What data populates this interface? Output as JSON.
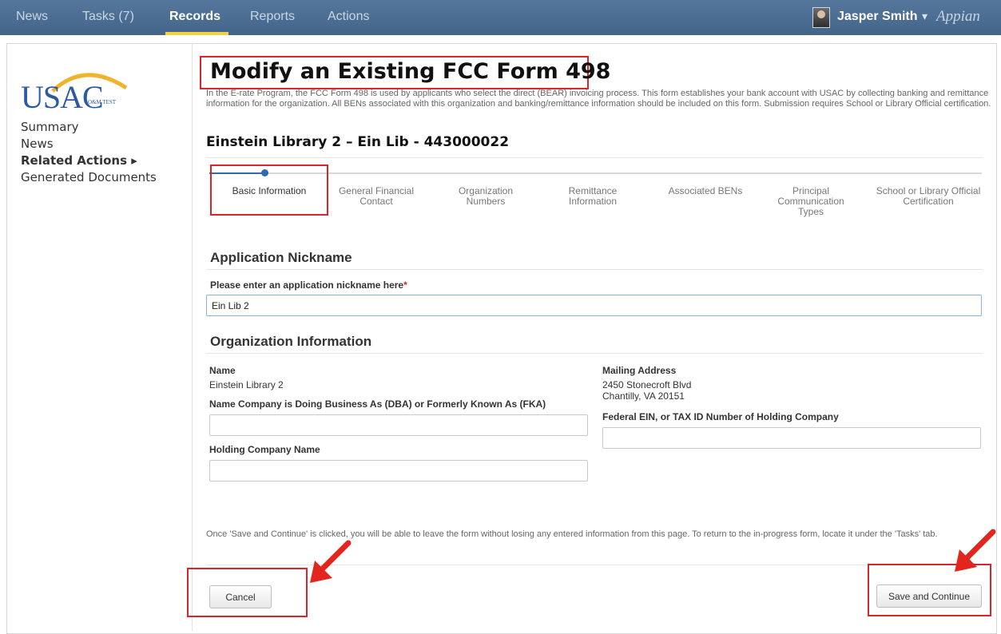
{
  "nav": {
    "items": [
      "News",
      "Tasks (7)",
      "Records",
      "Reports",
      "Actions"
    ],
    "active": "Records",
    "user_name": "Jasper Smith",
    "user_caret": "▾",
    "brand": "Appian"
  },
  "sidebar": {
    "logo_text": "USAC",
    "logo_subtext": "O&M TEST",
    "links": [
      "Summary",
      "News",
      "Related Actions ▸",
      "Generated Documents"
    ]
  },
  "page": {
    "title": "Modify an Existing FCC Form 498",
    "intro": "In the E-rate Program, the FCC Form 498 is used by applicants who select the direct (BEAR) invoicing process. This form establishes your bank account with USAC by collecting banking and remittance information for the organization. All BENs associated with this organization and banking/remittance information should be included on this form. Submission requires School or Library Official certification.",
    "record_title": "Einstein Library 2 – Ein Lib - 443000022"
  },
  "steps": [
    "Basic Information",
    "General Financial Contact",
    "Organization Numbers",
    "Remittance Information",
    "Associated BENs",
    "Principal Communication Types",
    "School or Library Official Certification"
  ],
  "application": {
    "heading": "Application Nickname",
    "nickname_label": "Please enter an application nickname here",
    "required_mark": "*",
    "nickname_value": "Ein Lib 2"
  },
  "organization": {
    "heading": "Organization Information",
    "name_label": "Name",
    "name_value": "Einstein Library 2",
    "dba_label": "Name Company is Doing Business As (DBA) or Formerly Known As (FKA)",
    "dba_value": "",
    "holding_label": "Holding Company Name",
    "holding_value": "",
    "mailing_label": "Mailing Address",
    "mailing_line1": "2450 Stonecroft Blvd",
    "mailing_line2": "Chantilly, VA 20151",
    "ein_label": "Federal EIN, or TAX ID Number of Holding Company",
    "ein_value": ""
  },
  "footer": {
    "note": "Once 'Save and Continue' is clicked, you will be able to leave the form without losing any entered information from this page. To return to the in-progress form, locate it under the 'Tasks' tab.",
    "cancel_label": "Cancel",
    "save_label": "Save and Continue"
  },
  "colors": {
    "nav_bar": "#486c93",
    "active_underline": "#f2d145",
    "highlight_red": "#d9252b",
    "step_blue": "#2c6bb0"
  }
}
